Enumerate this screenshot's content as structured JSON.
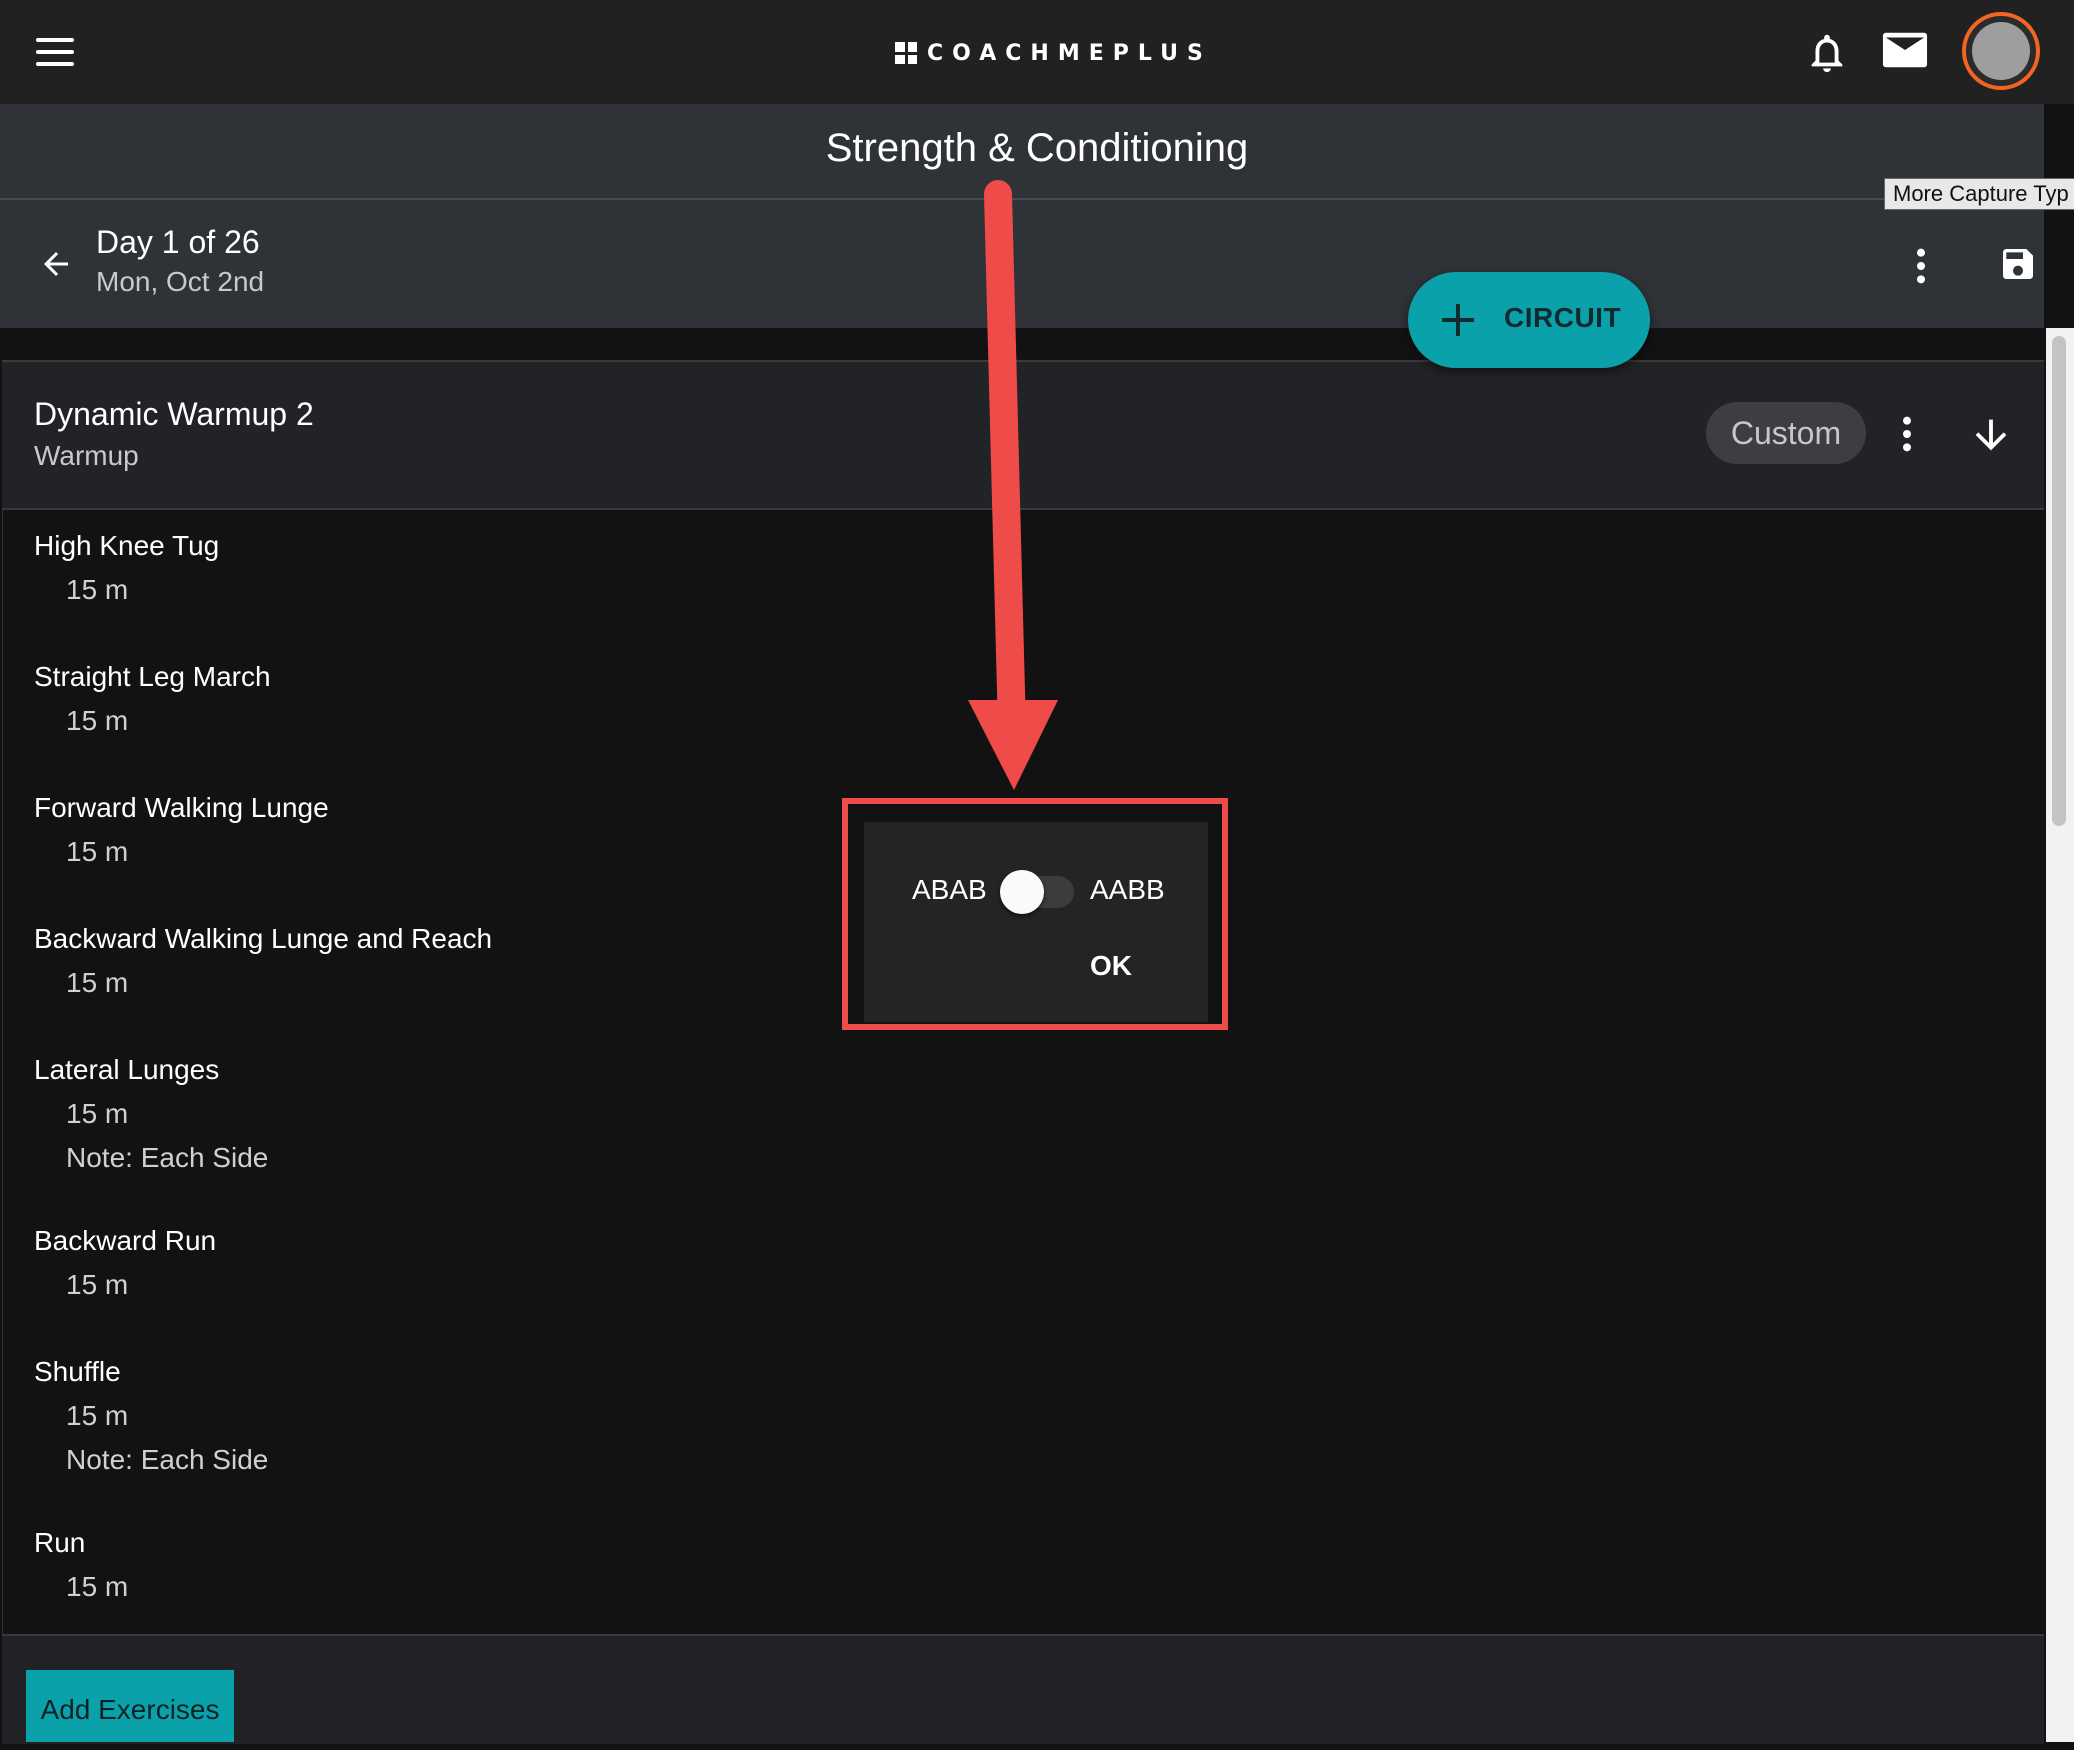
{
  "app": {
    "logo_text": "COACHMEPLUS",
    "accent_color": "#0aa1aa",
    "avatar_ring_color": "#f26522",
    "annotation_color": "#ef4b49"
  },
  "header": {
    "title": "Strength & Conditioning",
    "icons": [
      "menu-icon",
      "bell-icon",
      "mail-icon",
      "avatar"
    ]
  },
  "tooltip": {
    "text": "More Capture Typ"
  },
  "day": {
    "title": "Day 1 of 26",
    "date": "Mon, Oct 2nd"
  },
  "fab": {
    "label": "CIRCUIT"
  },
  "block": {
    "title": "Dynamic Warmup 2",
    "subtitle": "Warmup",
    "chip": "Custom"
  },
  "exercises": [
    {
      "name": "High Knee Tug",
      "value": "15 m",
      "note": ""
    },
    {
      "name": "Straight Leg March",
      "value": "15 m",
      "note": ""
    },
    {
      "name": "Forward Walking Lunge",
      "value": "15 m",
      "note": ""
    },
    {
      "name": "Backward Walking Lunge and Reach",
      "value": "15 m",
      "note": ""
    },
    {
      "name": "Lateral Lunges",
      "value": "15 m",
      "note": "Note: Each Side"
    },
    {
      "name": "Backward Run",
      "value": "15 m",
      "note": ""
    },
    {
      "name": "Shuffle",
      "value": "15 m",
      "note": "Note: Each Side"
    },
    {
      "name": "Run",
      "value": "15 m",
      "note": ""
    }
  ],
  "footer": {
    "add_label": "Add Exercises"
  },
  "dialog": {
    "option_left": "ABAB",
    "option_right": "AABB",
    "toggle_on": false,
    "ok_label": "OK"
  }
}
